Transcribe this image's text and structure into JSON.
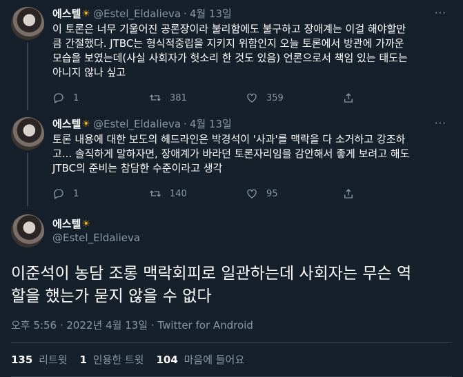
{
  "tweets": [
    {
      "name": "에스텔",
      "handle": "@Estel_Eldalieva",
      "date": "4월 13일",
      "text": "이 토론은 너무 기울어진 공론장이라 불리함에도 불구하고 장애계는 이걸 해야할만\n큼 간절했다. JTBC는 형식적중립을 지키지 위함인지 오늘 토론에서 방관에 가까운\n모습을 보였는데(사실 사회자가 헛소리 한 것도 있음) 언론으로서 책임 있는 태도는\n아니지 않나 싶고",
      "replies": "1",
      "retweets": "381",
      "likes": "359"
    },
    {
      "name": "에스텔",
      "handle": "@Estel_Eldalieva",
      "date": "4월 13일",
      "text": "토론 내용에 대한 보도의 헤드라인은 박경석이 '사과'를 맥락을 다 소거하고 강조하\n고... 솔직하게 말하자면, 장애계가 바라던 토론자리임을 감안해서 좋게 보려고 해도\nJTBC의 준비는 참담한 수준이라고 생각",
      "replies": "1",
      "retweets": "140",
      "likes": "95"
    }
  ],
  "main": {
    "name": "에스텔",
    "handle": "@Estel_Eldalieva",
    "text": "이준석이 농담 조롱 맥락회피로 일관하는데 사회자는 무슨 역\n할을 했는가 묻지 않을 수 없다",
    "time": "오후 5:56 · 2022년 4월 13일",
    "source": "Twitter for Android",
    "retweet_count": "135",
    "retweet_label": "리트윗",
    "quote_count": "1",
    "quote_label": "인용한 트윗",
    "like_count": "104",
    "like_label": "마음에 들어요"
  },
  "ui": {
    "sep": "·",
    "more": "···",
    "sun": "☀"
  },
  "colors": {
    "background": "#15202b",
    "secondary_text": "#8899a6",
    "divider": "#38444d"
  }
}
